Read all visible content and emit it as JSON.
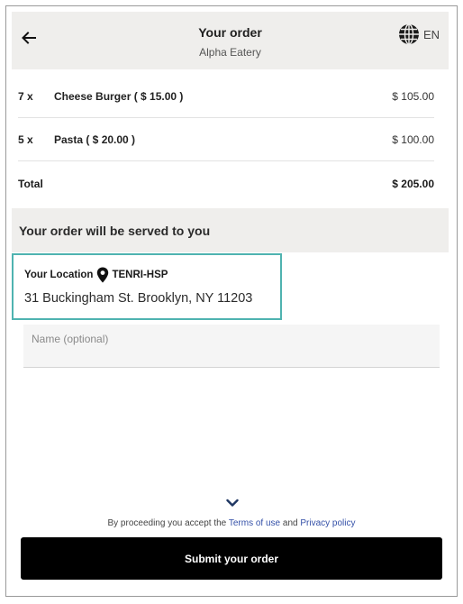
{
  "header": {
    "title": "Your order",
    "subtitle": "Alpha Eatery",
    "language": "EN"
  },
  "items": [
    {
      "qty": "7 x",
      "name": "Cheese Burger ( $ 15.00 )",
      "price": "$ 105.00"
    },
    {
      "qty": "5 x",
      "name": "Pasta ( $ 20.00 )",
      "price": "$ 100.00"
    }
  ],
  "total": {
    "label": "Total",
    "value": "$ 205.00"
  },
  "served_banner": "Your order will be served to you",
  "location": {
    "label": "Your Location",
    "code": "TENRI-HSP",
    "address": "31 Buckingham St. Brooklyn, NY 11203"
  },
  "name_field": {
    "placeholder": "Name (optional)",
    "value": ""
  },
  "terms": {
    "prefix": "By proceeding you accept the",
    "terms_link": "Terms of use",
    "conjunction": "and",
    "privacy_link": "Privacy policy"
  },
  "submit_label": "Submit your order",
  "colors": {
    "header_bg": "#efeeec",
    "highlight_border": "#4fb3b0",
    "link": "#3450a8",
    "submit_bg": "#000000"
  },
  "icons": [
    "back-arrow-icon",
    "globe-icon",
    "location-pin-icon",
    "chevron-down-icon"
  ]
}
